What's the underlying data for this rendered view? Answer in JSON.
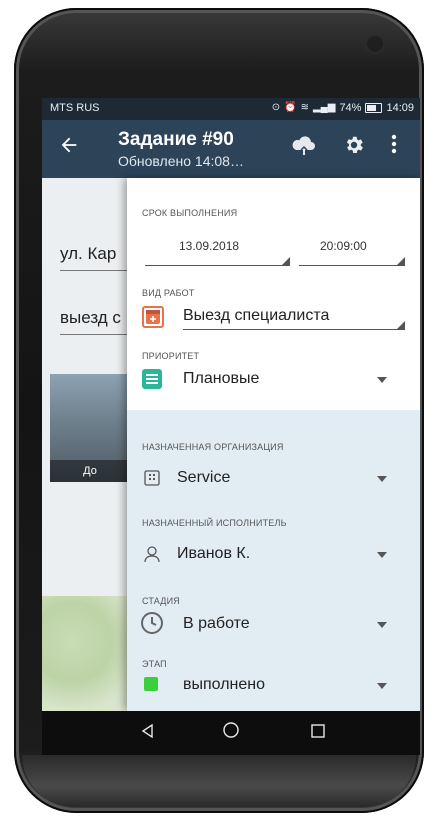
{
  "status_bar": {
    "carrier": "MTS RUS",
    "battery_percent": "74%",
    "time": "14:09"
  },
  "app_bar": {
    "title": "Задание #90",
    "subtitle": "Обновлено 14:08…"
  },
  "background": {
    "field1": "ул. Кар",
    "field2": "выезд с",
    "photo_label": "До"
  },
  "form": {
    "deadline": {
      "label": "СРОК ВЫПОЛНЕНИЯ",
      "date": "13.09.2018",
      "time": "20:09:00"
    },
    "work_type": {
      "label": "ВИД РАБОТ",
      "value": "Выезд специалиста",
      "color": "#e8734a"
    },
    "priority": {
      "label": "ПРИОРИТЕТ",
      "value": "Плановые",
      "color": "#2bb59a"
    },
    "organization": {
      "label": "НАЗНАЧЕННАЯ ОРГАНИЗАЦИЯ",
      "value": "Service"
    },
    "executor": {
      "label": "НАЗНАЧЕННЫЙ ИСПОЛНИТЕЛЬ",
      "value": "Иванов К."
    },
    "stage": {
      "label": "СТАДИЯ",
      "value": "В работе"
    },
    "step": {
      "label": "ЭТАП",
      "value": "выполнено",
      "color": "#3ccf3c"
    }
  },
  "colors": {
    "app_bar": "#2c4358",
    "status_bar": "#1d2a35",
    "panel_lower": "#e2edf3"
  }
}
